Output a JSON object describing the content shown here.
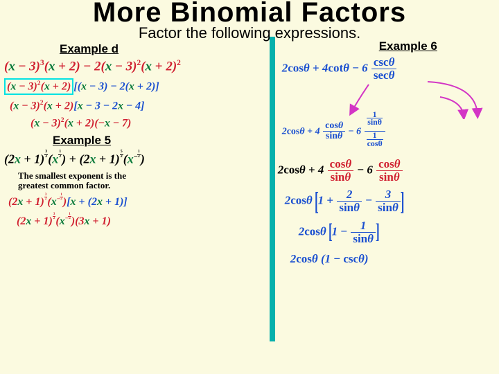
{
  "title": "More Binomial Factors",
  "subtitle": "Factor the following expressions.",
  "labels": {
    "exD": "Example d",
    "ex5": "Example 5",
    "ex6": "Example 6"
  },
  "note": "The smallest exponent is the greatest common factor.",
  "leftD": {
    "l1": "(x − 3)³(x + 2) − 2(x − 3)²(x + 2)²",
    "l2": "(x − 3)²(x + 2)[(x − 3) − 2(x + 2)]",
    "l3": "(x − 3)²(x + 2)[x − 3 − 2x − 4]",
    "l4": "(x − 3)²(x + 2)(−x − 7)"
  },
  "left5": {
    "l1": "(2x + 1)^{3/2}(x^{1/2}) + (2x + 1)^{5/2}(x^{-1/2})",
    "l2": "(2x + 1)^{3/2}(x^{-1/2})[x + (2x + 1)]",
    "l3": "(2x + 1)^{3/2}(x^{-1/2})(3x + 1)"
  },
  "right": {
    "e1": "2cosθ + 4cotθ − 6 cscθ/secθ",
    "rw1": "cotθ = cosθ/sinθ ; cscθ = 1/sinθ ; secθ = 1/cosθ",
    "e2": "2cosθ + 4 cosθ/sinθ − 6 cosθ/sinθ",
    "e3": "2cosθ [1 + 2/sinθ − 3/sinθ]",
    "e4": "2cosθ [1 − 1/sinθ]",
    "e5": "2cosθ (1 − cscθ)"
  }
}
